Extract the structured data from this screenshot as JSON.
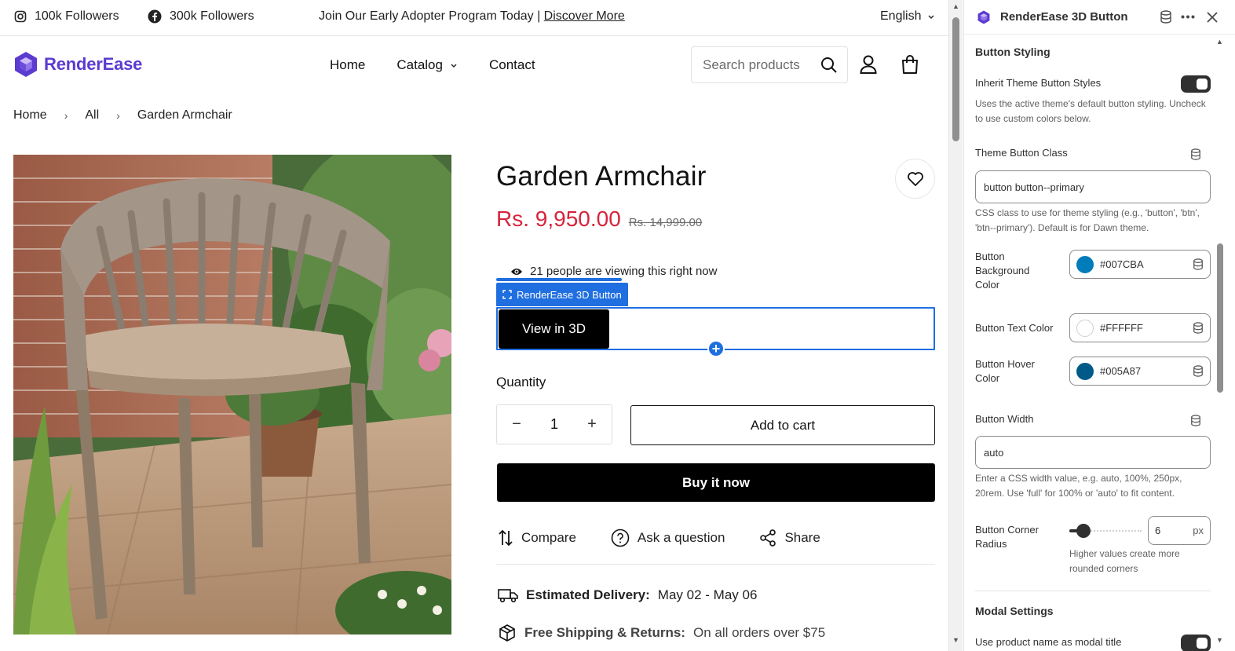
{
  "announcement": {
    "instagram_followers": "100k Followers",
    "facebook_followers": "300k Followers",
    "message": "Join Our Early Adopter Program Today |",
    "link": "Discover More",
    "language": "English"
  },
  "header": {
    "logo_text": "RenderEase",
    "nav": [
      "Home",
      "Catalog",
      "Contact"
    ],
    "search_placeholder": "Search products"
  },
  "breadcrumb": [
    "Home",
    "All",
    "Garden Armchair"
  ],
  "product": {
    "title": "Garden Armchair",
    "price": "Rs. 9,950.00",
    "compare_price": "Rs. 14,999.00",
    "viewing": "21 people are viewing this right now",
    "app_block_label": "RenderEase 3D Button",
    "view_3d_label": "View in 3D",
    "quantity_label": "Quantity",
    "quantity_value": "1",
    "add_to_cart": "Add to cart",
    "buy_now": "Buy it now",
    "actions": {
      "compare": "Compare",
      "ask": "Ask a question",
      "share": "Share"
    },
    "delivery_label": "Estimated Delivery:",
    "delivery_value": "May 02 - May 06",
    "shipping_label": "Free Shipping & Returns:",
    "shipping_value": "On all orders over $75"
  },
  "panel": {
    "title": "RenderEase 3D Button",
    "section_button_styling": "Button Styling",
    "inherit_label": "Inherit Theme Button Styles",
    "inherit_on": true,
    "inherit_help": "Uses the active theme's default button styling. Uncheck to use custom colors below.",
    "theme_class_label": "Theme Button Class",
    "theme_class_value": "button button--primary",
    "theme_class_help": "CSS class to use for theme styling (e.g., 'button', 'btn', 'btn--primary'). Default is for Dawn theme.",
    "bg_color_label": "Button Background Color",
    "bg_color_value": "#007CBA",
    "text_color_label": "Button Text Color",
    "text_color_value": "#FFFFFF",
    "hover_color_label": "Button Hover Color",
    "hover_color_value": "#005A87",
    "width_label": "Button Width",
    "width_value": "auto",
    "width_help": "Enter a CSS width value, e.g. auto, 100%, 250px, 20rem. Use 'full' for 100% or 'auto' to fit content.",
    "radius_label": "Button Corner Radius",
    "radius_value": "6",
    "radius_unit": "px",
    "radius_help": "Higher values create more rounded corners",
    "section_modal": "Modal Settings",
    "modal_title_label": "Use product name as modal title"
  },
  "colors": {
    "brand": "#5B3BD0",
    "sale_price": "#D6243C",
    "editor_accent": "#1F6FE0",
    "swatch_bg": "#007CBA",
    "swatch_text": "#FFFFFF",
    "swatch_hover": "#005A87"
  }
}
